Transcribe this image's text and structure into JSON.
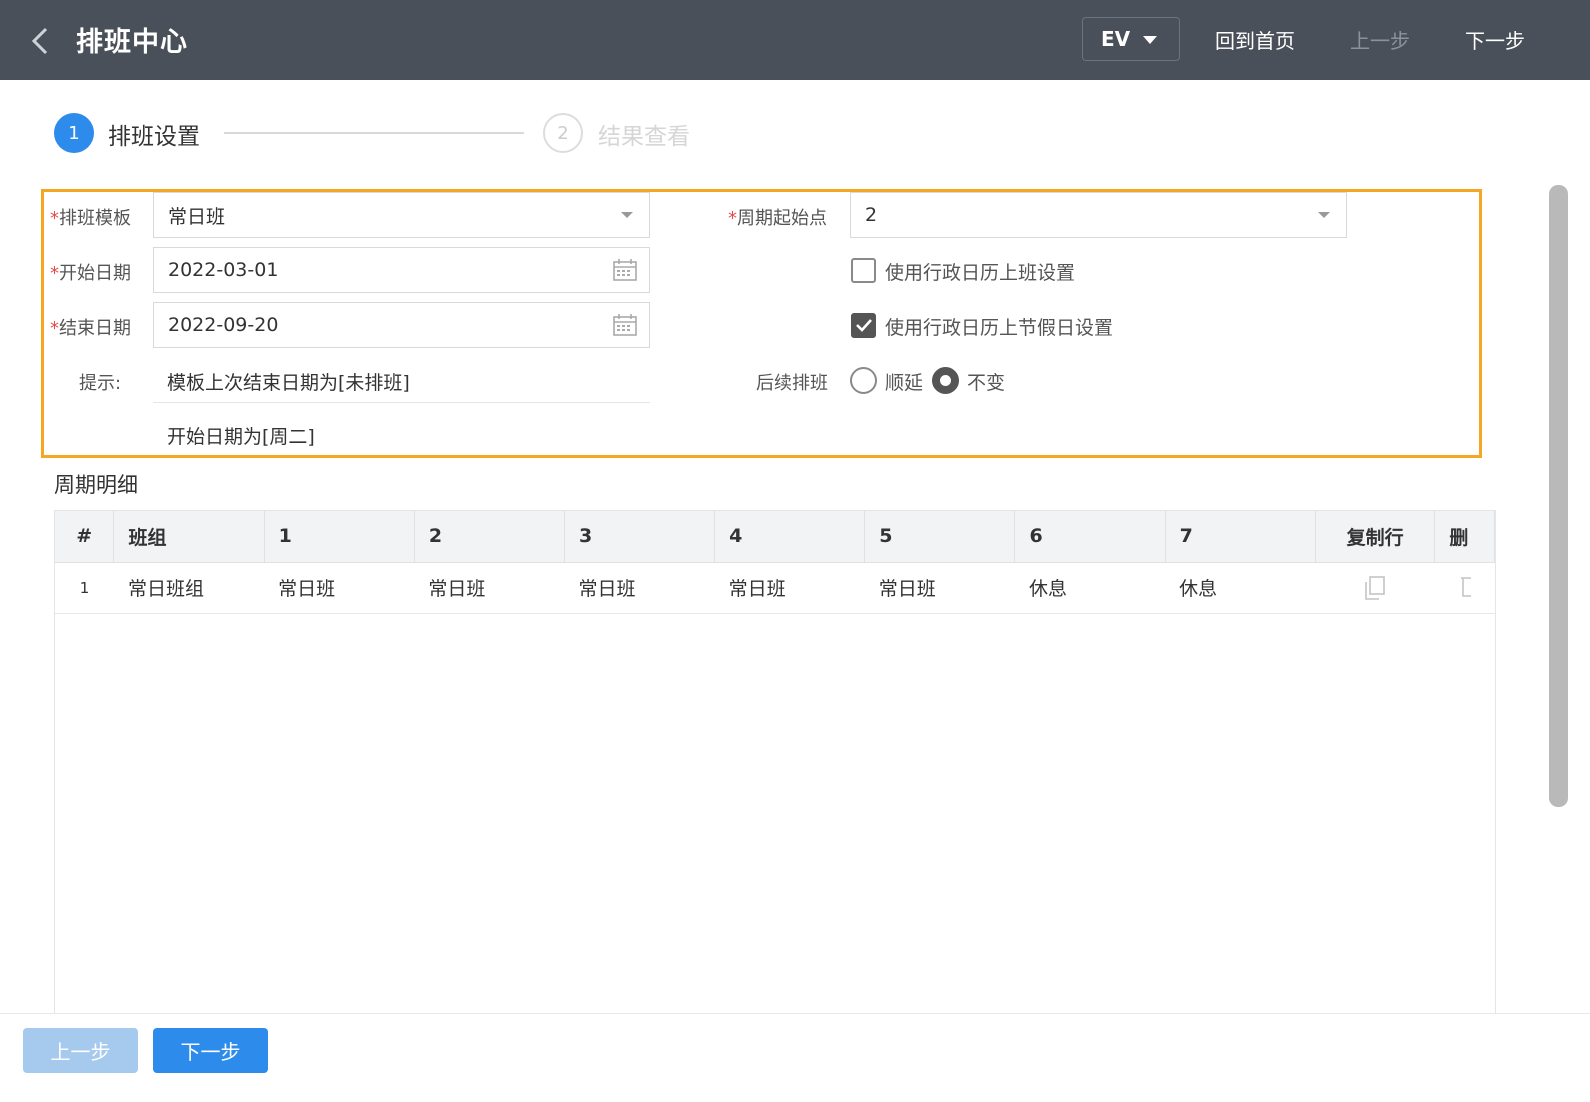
{
  "header": {
    "title": "排班中心",
    "env_select": "EV",
    "home_link": "回到首页",
    "prev_link": "上一步",
    "next_link": "下一步"
  },
  "steps": [
    {
      "num": "1",
      "label": "排班设置"
    },
    {
      "num": "2",
      "label": "结果查看"
    }
  ],
  "form": {
    "template_label": "排班模板",
    "template_value": "常日班",
    "start_label": "开始日期",
    "start_value": "2022-03-01",
    "end_label": "结束日期",
    "end_value": "2022-09-20",
    "hint_label": "提示:",
    "hint_line1": "模板上次结束日期为[未排班]",
    "hint_line2": "开始日期为[周二]",
    "cycle_start_label": "周期起始点",
    "cycle_start_value": "2",
    "use_work_calendar": "使用行政日历上班设置",
    "use_holiday_calendar": "使用行政日历上节假日设置",
    "subsequent_label": "后续排班",
    "option_postpone": "顺延",
    "option_unchanged": "不变",
    "required_mark": "*"
  },
  "section": {
    "title": "周期明细"
  },
  "table": {
    "headers": [
      "#",
      "班组",
      "1",
      "2",
      "3",
      "4",
      "5",
      "6",
      "7",
      "复制行",
      "删"
    ],
    "rows": [
      {
        "num": "1",
        "group": "常日班组",
        "d1": "常日班",
        "d2": "常日班",
        "d3": "常日班",
        "d4": "常日班",
        "d5": "常日班",
        "d6": "休息",
        "d7": "休息"
      }
    ]
  },
  "footer": {
    "prev_button": "上一步",
    "next_button": "下一步"
  },
  "colors": {
    "header_bg": "#4a5059",
    "primary": "#2d8ceb",
    "highlight_border": "#f5a623"
  }
}
